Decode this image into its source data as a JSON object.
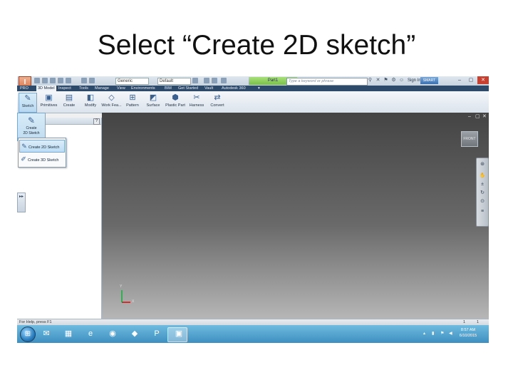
{
  "slide": {
    "title": "Select “Create 2D sketch”"
  },
  "app": {
    "logo_letter": "I",
    "pro_label": "PRO",
    "style_combo": "Generic",
    "appearance_combo": "Default",
    "document_title": "Part1",
    "search_placeholder": "Type a keyword or phrase",
    "signin": "Sign In",
    "smart_label": "SMART Ink",
    "window_controls": [
      "–",
      "▢",
      "✕"
    ]
  },
  "tabs": [
    "3D Model",
    "Inspect",
    "Tools",
    "Manage",
    "View",
    "Environments",
    "BIM",
    "Get Started",
    "Vault",
    "Autodesk 360"
  ],
  "ribbon": {
    "buttons": [
      "Sketch",
      "Primitives",
      "Create",
      "Modify",
      "Work Fea...",
      "Pattern",
      "Surface",
      "Plastic Part",
      "Harness",
      "Convert"
    ]
  },
  "sketch_dropdown": {
    "label_line1": "Create",
    "label_line2": "2D Sketch"
  },
  "flyout": {
    "items": [
      "Create 2D Sketch",
      "Create 3D Sketch"
    ]
  },
  "browser": {
    "help": "?",
    "handle": "▸▸"
  },
  "viewport": {
    "controls": [
      "–",
      "▢",
      "✕"
    ],
    "viewcube_label": "FRONT",
    "axes": {
      "y": "Y",
      "x": "X"
    }
  },
  "status": {
    "text": "For Help, press F1",
    "num1": "1",
    "num2": "1"
  },
  "taskbar": {
    "clock_time": "8:57 AM",
    "clock_date": "6/10/2015"
  }
}
